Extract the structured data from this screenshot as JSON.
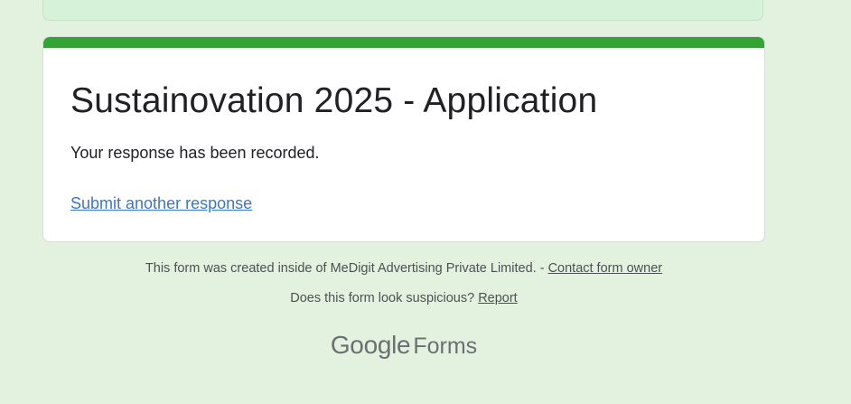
{
  "form": {
    "title": "Sustainovation 2025 - Application",
    "confirmation_message": "Your response has been recorded.",
    "submit_another_label": "Submit another response"
  },
  "footer": {
    "created_text": "This form was created inside of MeDigit Advertising Private Limited. - ",
    "contact_owner_label": "Contact form owner",
    "suspicious_text": "Does this form look suspicious? ",
    "report_label": "Report"
  },
  "branding": {
    "google": "Google",
    "forms": "Forms"
  },
  "colors": {
    "page_background": "#e3f1df",
    "accent": "#33a433",
    "link": "#3b78c4",
    "title_text": "#202124"
  }
}
